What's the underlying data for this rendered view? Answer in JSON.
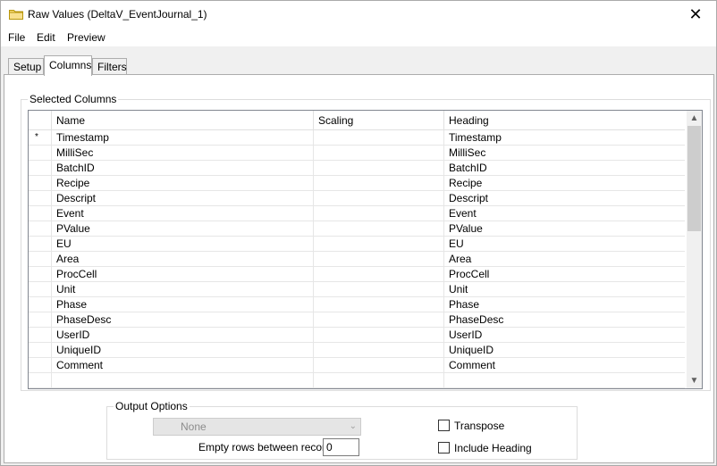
{
  "window": {
    "title": "Raw Values (DeltaV_EventJournal_1)",
    "close_glyph": "✕",
    "title_icon": "folder-icon"
  },
  "menu": {
    "items": [
      "File",
      "Edit",
      "Preview"
    ]
  },
  "tabs": {
    "items": [
      "Setup",
      "Columns",
      "Filters"
    ],
    "active": "Columns"
  },
  "selected_columns": {
    "legend": "Selected Columns",
    "headers": {
      "name": "Name",
      "scaling": "Scaling",
      "heading": "Heading"
    },
    "rows": [
      {
        "marker": "*",
        "name": "Timestamp",
        "scaling": "",
        "heading": "Timestamp"
      },
      {
        "marker": "",
        "name": "MilliSec",
        "scaling": "",
        "heading": "MilliSec"
      },
      {
        "marker": "",
        "name": "BatchID",
        "scaling": "",
        "heading": "BatchID"
      },
      {
        "marker": "",
        "name": "Recipe",
        "scaling": "",
        "heading": "Recipe"
      },
      {
        "marker": "",
        "name": "Descript",
        "scaling": "",
        "heading": "Descript"
      },
      {
        "marker": "",
        "name": "Event",
        "scaling": "",
        "heading": "Event"
      },
      {
        "marker": "",
        "name": "PValue",
        "scaling": "",
        "heading": "PValue"
      },
      {
        "marker": "",
        "name": "EU",
        "scaling": "",
        "heading": "EU"
      },
      {
        "marker": "",
        "name": "Area",
        "scaling": "",
        "heading": "Area"
      },
      {
        "marker": "",
        "name": "ProcCell",
        "scaling": "",
        "heading": "ProcCell"
      },
      {
        "marker": "",
        "name": "Unit",
        "scaling": "",
        "heading": "Unit"
      },
      {
        "marker": "",
        "name": "Phase",
        "scaling": "",
        "heading": "Phase"
      },
      {
        "marker": "",
        "name": "PhaseDesc",
        "scaling": "",
        "heading": "PhaseDesc"
      },
      {
        "marker": "",
        "name": "UserID",
        "scaling": "",
        "heading": "UserID"
      },
      {
        "marker": "",
        "name": "UniqueID",
        "scaling": "",
        "heading": "UniqueID"
      },
      {
        "marker": "",
        "name": "Comment",
        "scaling": "",
        "heading": "Comment"
      },
      {
        "marker": "",
        "name": "",
        "scaling": "",
        "heading": ""
      }
    ]
  },
  "output_options": {
    "legend": "Output Options",
    "select_value": "None",
    "empty_rows_label": "Empty rows between records",
    "empty_rows_value": "0",
    "transpose_label": "Transpose",
    "transpose_checked": false,
    "include_heading_label": "Include Heading",
    "include_heading_checked": false
  }
}
